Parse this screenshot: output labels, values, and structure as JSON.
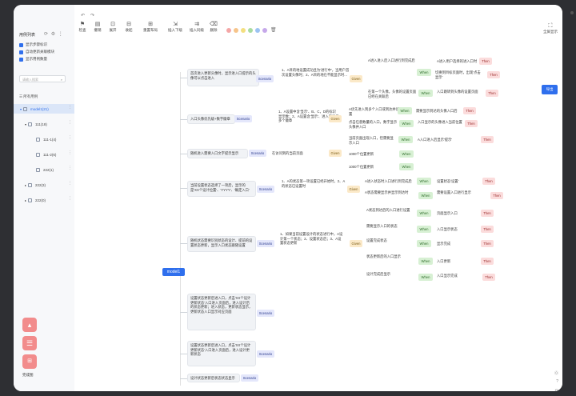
{
  "sidebar": {
    "title": "用例列表",
    "checkboxes": [
      "显示步骤标识",
      "自动更新关联模块",
      "显示用例数量"
    ],
    "search_placeholder": "请输入搜索",
    "section": "所有用例",
    "tree": [
      {
        "label": "model1(21)",
        "selected": true
      },
      {
        "label": "111(18)"
      },
      {
        "label": "111-1(4)"
      },
      {
        "label": "111-2(6)"
      },
      {
        "label": "222(1)"
      },
      {
        "label": "222(3)"
      },
      {
        "label": "222(0)"
      }
    ],
    "footer_label": "完成图"
  },
  "toolbar": {
    "buttons": [
      {
        "label": "检查",
        "icon": "check-icon"
      },
      {
        "label": "撤销",
        "icon": "undo-icon"
      },
      {
        "label": "展开",
        "icon": "expand-icon"
      },
      {
        "label": "收起",
        "icon": "collapse-icon"
      },
      {
        "label": "重置布局",
        "icon": "layout-icon"
      },
      {
        "label": "插入下级",
        "icon": "insert-child-icon"
      },
      {
        "label": "插入同级",
        "icon": "insert-sibling-icon"
      },
      {
        "label": "删除",
        "icon": "delete-icon"
      }
    ],
    "colors": [
      "#f4a6a6",
      "#f6c48a",
      "#f3df80",
      "#a8dba0",
      "#9cc3f2",
      "#c6a8ea"
    ],
    "fullscreen_label": "全屏显示",
    "export_label": "导出"
  },
  "canvas": {
    "root": "model1",
    "branches": [
      {
        "scenario_text": "首次进入更新头像时，显示进入口提示的头像可以点击进入",
        "given_text": "1、A目的地设置成功且为'进行中'，当用户首次设置头像时；2、A目的地在不能显示时...",
        "when_rows": [
          {
            "given": "A进入进入后入口进行到完成后",
            "when": "A进入用户选择的进入口时",
            "then": "切换到目标页面时，出现'点击显示'"
          },
          {
            "given": "在第一个头像，头像的设置页面已经在关联后",
            "when": "在首次访问时",
            "then": "入口跳转到头像的设置页面"
          }
        ]
      },
      {
        "scenario_text": "入口头像优先级+数字徽章",
        "given_text": "1、A设置中含'显示'、B、C，D的标识显示数；2、A设置含'显示'、进入口显示多个徽章",
        "when_rows": [
          {
            "given": "A优先进入到多个入口或到达并设置",
            "when": "点击入口",
            "then": "需要显示到达的头像入口后"
          },
          {
            "given": "点击任意数量的入口，数字显示头像并入口",
            "when": "点击入口",
            "then": "入口显示的头像进入当前位置"
          }
        ]
      },
      {
        "scenario_text": "随机进入需要入口文字提示显示",
        "given_text": "在访问到的当前页面",
        "when_rows": [
          {
            "given": "当前页面出现入口，但需要显示入口",
            "when": "A到达进入口时",
            "then": "A入口进入后显示'提示'"
          },
          {
            "given": "1000个位置更新",
            "when": "进入",
            "then": "显示"
          },
          {
            "given": "1000个位置更新",
            "when": "进入",
            "then": "显示"
          }
        ]
      },
      {
        "scenario_text": "当前设置状态选择了一项后，显示的是'XX个设计位置'、'YYYY'、'确定入口'",
        "given_text": "1、A的状态第一项设置已经开始时，2、A的状态已设置时",
        "when_rows": [
          {
            "given": "A进入状态时入口进行到完成后",
            "when": "进入",
            "then": "设置状态'设置'"
          },
          {
            "given": "A状态需要显示并显示到达时",
            "when": "进入",
            "then": "需要设置入口进行显示"
          }
        ]
      },
      {
        "scenario_text": "随机状态需要识别状态的设计、提前的设置状态更新，显示入口状态跟随设置",
        "given_text": "1、如果当前设置设计的状态进行中，A设计第一个状态；2、设置状态后；3、A设置状态更新",
        "when_rows": [
          {
            "given": "A状态到达后的入口进行设置",
            "when": "进入",
            "then": "页面显示入口"
          },
          {
            "given": "需要显示入口的状态",
            "when": "进入",
            "then": "入口显示状态"
          },
          {
            "given": "设置完成状态",
            "when": "进入",
            "then": "显示完成"
          },
          {
            "given": "状态更新后的入口显示",
            "when": "进入",
            "then": "入口更新"
          },
          {
            "given": "设计完成后显示",
            "when": "进入",
            "then": "入口显示完成"
          }
        ]
      },
      {
        "scenario_text": "设置状态更新后进入口，点击'XX个设计更新状态'入口进入页面后，进入设计后的状态更新；进入状态，更新状态显示，更新状态入口显示对应页面",
        "given_text": "",
        "when_rows": []
      },
      {
        "scenario_text": "设置状态更新后进入口，点击'XX个设计更新状态'入口进入页面后，进入设计更新状态",
        "given_text": "",
        "when_rows": []
      },
      {
        "scenario_text": "设计状态更新后状态状态显示",
        "given_text": "",
        "when_rows": []
      }
    ],
    "tags": {
      "scenario": "Scenario",
      "given": "Given",
      "when": "When",
      "then": "Then"
    }
  }
}
